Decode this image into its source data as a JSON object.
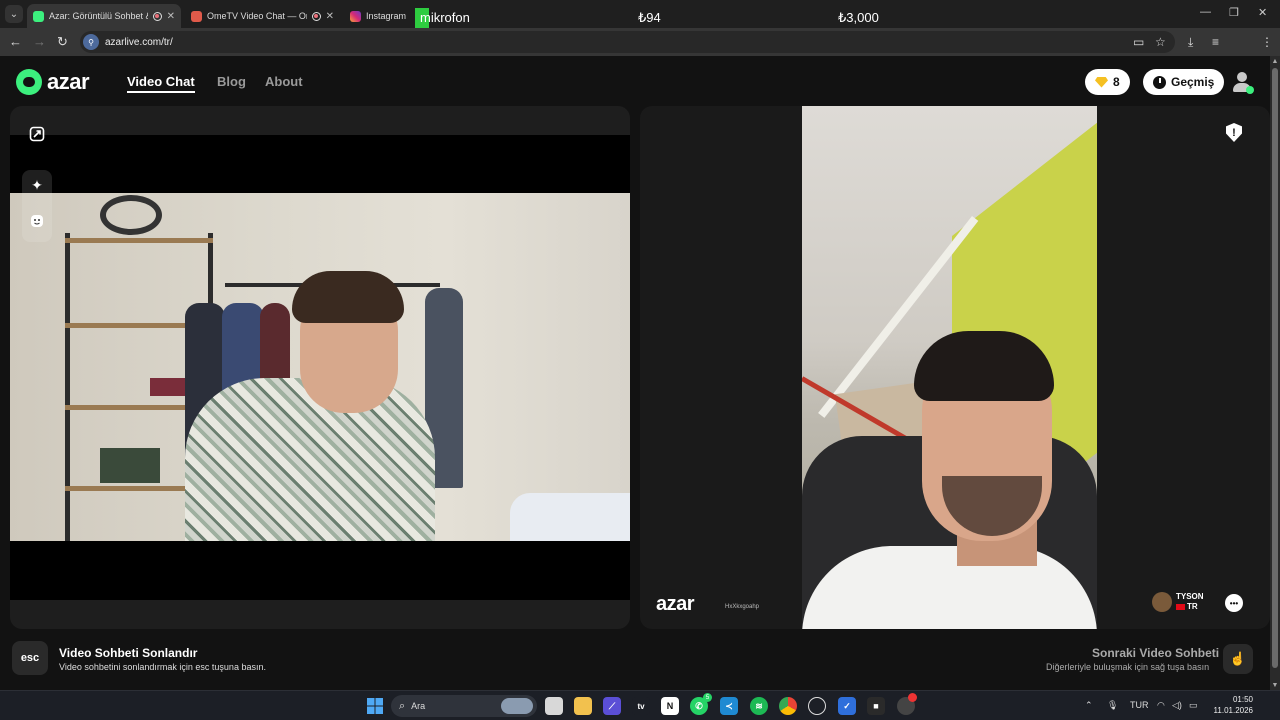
{
  "browser": {
    "tabs": [
      {
        "title": "Azar: Görüntülü Sohbet & V",
        "active": true
      },
      {
        "title": "OmeTV Video Chat — Ome",
        "active": false
      },
      {
        "title": "Instagram",
        "active": false
      }
    ],
    "overlay": {
      "mic_label": "mikrofon",
      "value_a": "₺94",
      "value_b": "₺3,000"
    },
    "url": "azarlive.com/tr/",
    "profile_initial": "Y"
  },
  "site": {
    "logo_text": "azar",
    "nav": [
      {
        "label": "Video Chat",
        "active": true
      },
      {
        "label": "Blog",
        "active": false
      },
      {
        "label": "About",
        "active": false
      }
    ],
    "gems": "8",
    "history_label": "Geçmiş"
  },
  "remote": {
    "watermark_logo": "azar",
    "watermark_id": "HxXkxgoahp",
    "user_name": "TYSON",
    "user_country": "TR"
  },
  "hints": {
    "esc_key": "esc",
    "end_title": "Video Sohbeti Sonlandır",
    "end_sub": "Video sohbetini sonlandırmak için esc tuşuna basın.",
    "next_title": "Sonraki Video Sohbeti",
    "next_sub": "Diğerleriyle buluşmak için sağ tuşa basın"
  },
  "taskbar": {
    "search_label": "Ara",
    "language": "TUR",
    "time": "01:50",
    "date": "11.01.2026",
    "whatsapp_badge": "5"
  },
  "colors": {
    "brand_green": "#3cf07e",
    "gem_gold": "#f5c022",
    "bg": "#121212"
  }
}
